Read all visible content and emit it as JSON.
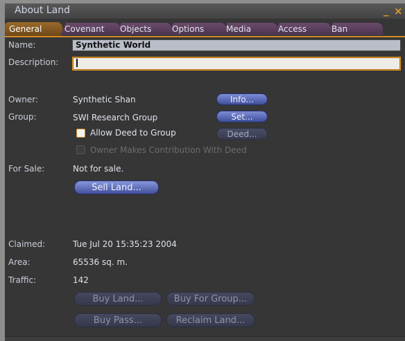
{
  "window": {
    "title": "About Land",
    "minimize_glyph": "_",
    "close_glyph": "×"
  },
  "tabs": [
    {
      "label": "General",
      "active": true
    },
    {
      "label": "Covenant",
      "active": false
    },
    {
      "label": "Objects",
      "active": false
    },
    {
      "label": "Options",
      "active": false
    },
    {
      "label": "Media",
      "active": false
    },
    {
      "label": "Access",
      "active": false
    },
    {
      "label": "Ban",
      "active": false
    }
  ],
  "general": {
    "name_label": "Name:",
    "name_value": "Synthetic World",
    "description_label": "Description:",
    "description_value": "",
    "owner_label": "Owner:",
    "owner_value": "Synthetic Shan",
    "info_button": "Info...",
    "group_label": "Group:",
    "group_value": "SWI Research Group",
    "set_button": "Set...",
    "allow_deed_label": "Allow Deed to Group",
    "allow_deed_checked": false,
    "deed_button": "Deed...",
    "owner_contribution_label": "Owner Makes Contribution With Deed",
    "owner_contribution_checked": false,
    "for_sale_label": "For Sale:",
    "for_sale_value": "Not for sale.",
    "sell_land_button": "Sell Land...",
    "claimed_label": "Claimed:",
    "claimed_value": "Tue Jul 20 15:35:23 2004",
    "area_label": "Area:",
    "area_value": "65536 sq. m.",
    "traffic_label": "Traffic:",
    "traffic_value": "142",
    "buy_land_button": "Buy Land...",
    "buy_for_group_button": "Buy For Group...",
    "buy_pass_button": "Buy Pass...",
    "reclaim_land_button": "Reclaim Land..."
  },
  "colors": {
    "accent": "#d08a24",
    "button_blue": "#5a6bc0",
    "panel_bg": "#363636"
  }
}
